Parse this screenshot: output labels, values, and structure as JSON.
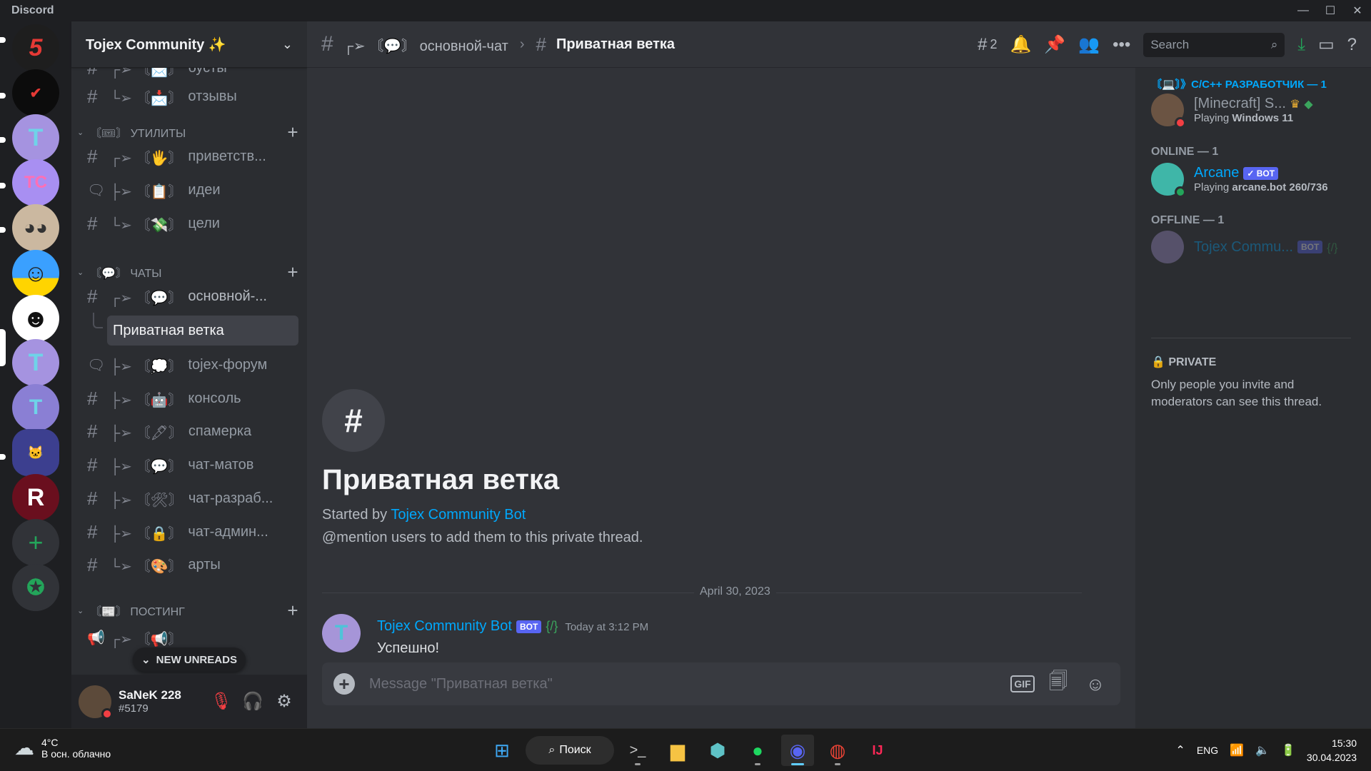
{
  "window": {
    "app_name": "Discord"
  },
  "server": {
    "name": "Tojex Community"
  },
  "servers": [
    {
      "name": "5-logo-server",
      "color": "#1e1e1e"
    },
    {
      "name": "black-logo-server",
      "color": "#111111"
    },
    {
      "name": "tojex-t-server",
      "color": "#9c8fd8"
    },
    {
      "name": "tcraft-server",
      "color": "#a68ff0"
    },
    {
      "name": "cat-server",
      "color": "#c9b59d"
    },
    {
      "name": "smile-server",
      "color": "#3aa0ff"
    },
    {
      "name": "face-server",
      "color": "#ffffff"
    },
    {
      "name": "tojex-t2-server",
      "color": "#9c8fd8"
    },
    {
      "name": "tojex-t3-server",
      "color": "#7d72c8"
    },
    {
      "name": "cat2-server",
      "color": "#3b3f8f"
    },
    {
      "name": "r-server",
      "color": "#7a1020"
    }
  ],
  "channels": {
    "top": [
      {
        "prefix": "┌➢ 〘📩〙",
        "name": "бусты"
      },
      {
        "prefix": "└➢ 〘📩〙",
        "name": "отзывы"
      }
    ],
    "cat_utils": {
      "label": "〘🎟〙 УТИЛИТЫ"
    },
    "utils": [
      {
        "prefix": "┌➢ 〘🖐〙",
        "name": "приветств..."
      },
      {
        "prefix": "├➢ 〘📋〙",
        "name": "идеи"
      },
      {
        "prefix": "└➢ 〘💸〙",
        "name": "цели"
      }
    ],
    "cat_chats": {
      "label": "〘💬〙 ЧАТЫ"
    },
    "chats": [
      {
        "prefix": "┌➢ 〘💬〙",
        "name": "основной-..."
      },
      {
        "prefix": "├➢ 〘💭〙",
        "name": "tojex-форум"
      },
      {
        "prefix": "├➢ 〘🤖〙",
        "name": "консоль"
      },
      {
        "prefix": "├➢ 〘🖋〙",
        "name": "спамерка"
      },
      {
        "prefix": "├➢ 〘💬〙",
        "name": "чат-матов"
      },
      {
        "prefix": "├➢ 〘🛠〙",
        "name": "чат-разраб..."
      },
      {
        "prefix": "├➢ 〘🔒〙",
        "name": "чат-админ..."
      },
      {
        "prefix": "└➢ 〘🎨〙",
        "name": "арты"
      }
    ],
    "active_thread": "Приватная ветка",
    "cat_posting": {
      "label": "〘📰〙 ПОСТИНГ"
    },
    "posting_first_prefix": "┌➢ 〘📢〙"
  },
  "new_unreads": "NEW UNREADS",
  "user": {
    "name": "SaNeK 228",
    "tag": "#5179"
  },
  "header": {
    "parent_prefix": "┌➢ 〘💬〙",
    "parent_channel": "основной-чат",
    "thread_name": "Приватная ветка",
    "threads_count": "2",
    "search_placeholder": "Search"
  },
  "intro": {
    "title": "Приватная ветка",
    "started_by_label": "Started by",
    "started_by_name": "Tojex Community Bot",
    "mention_hint": "@mention users to add them to this private thread."
  },
  "date_divider": "April 30, 2023",
  "message": {
    "author": "Tojex Community Bot",
    "badge": "BOT",
    "tag": "{/}",
    "timestamp": "Today at 3:12 PM",
    "text": "Успешно!"
  },
  "composer": {
    "placeholder": "Message \"Приватная ветка\"",
    "gif_label": "GIF"
  },
  "members": {
    "role_header": "〘💻〙》C/C++ РАЗРАБОТЧИК — 1",
    "role_member": {
      "name": "[Minecraft] S...",
      "activity_prefix": "Playing",
      "activity": "Windows 11"
    },
    "online_header": "ONLINE — 1",
    "online_member": {
      "name": "Arcane",
      "badge": "✓ BOT",
      "activity_prefix": "Playing",
      "activity": "arcane.bot 260/736"
    },
    "offline_header": "OFFLINE — 1",
    "offline_member": {
      "name": "Tojex Commu...",
      "badge": "BOT",
      "tag": "{/}"
    },
    "private_header": "PRIVATE",
    "private_text": "Only people you invite and moderators can see this thread."
  },
  "taskbar": {
    "temp": "4°C",
    "weather_desc": "В осн. облачно",
    "search_label": "Поиск",
    "lang": "ENG",
    "time": "15:30",
    "date": "30.04.2023"
  },
  "colors": {
    "accent": "#5865f2",
    "link": "#00a8fc",
    "bg_main": "#313338",
    "bg_sidebar": "#2b2d31",
    "dnd": "#f23f43",
    "online": "#23a55a"
  }
}
